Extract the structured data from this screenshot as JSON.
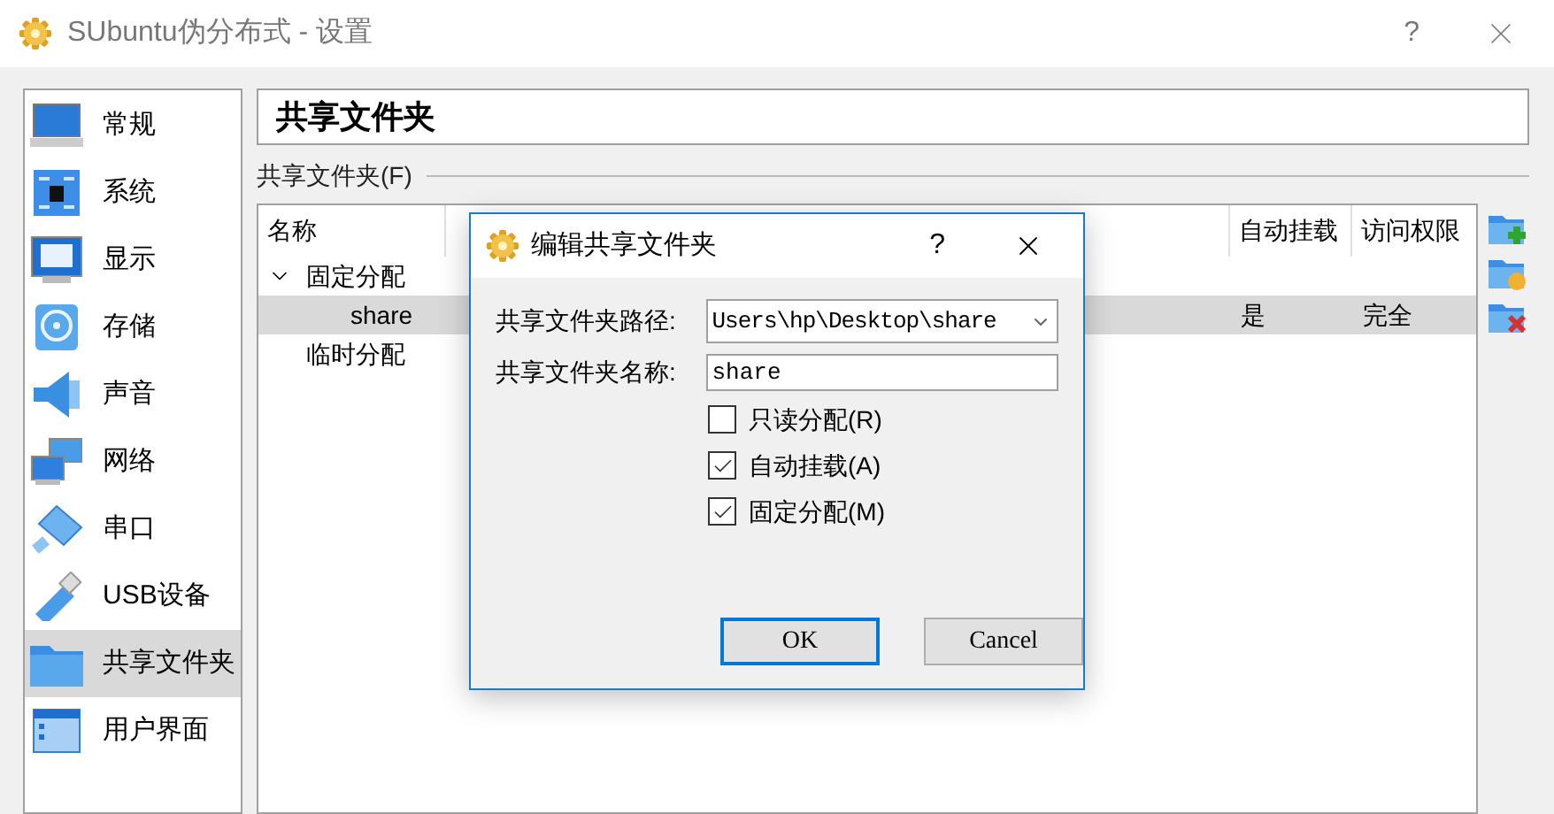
{
  "window": {
    "title": "SUbuntu伪分布式 - 设置",
    "help": "?"
  },
  "sidebar": {
    "items": [
      {
        "label": "常规",
        "kind": "monitor",
        "selected": false
      },
      {
        "label": "系统",
        "kind": "chip",
        "selected": false
      },
      {
        "label": "显示",
        "kind": "display",
        "selected": false
      },
      {
        "label": "存储",
        "kind": "disk",
        "selected": false
      },
      {
        "label": "声音",
        "kind": "speaker",
        "selected": false
      },
      {
        "label": "网络",
        "kind": "network",
        "selected": false
      },
      {
        "label": "串口",
        "kind": "serial",
        "selected": false
      },
      {
        "label": "USB设备",
        "kind": "usb",
        "selected": false
      },
      {
        "label": "共享文件夹",
        "kind": "folder",
        "selected": true
      },
      {
        "label": "用户界面",
        "kind": "window",
        "selected": false
      }
    ]
  },
  "page_title": "共享文件夹",
  "group_label": "共享文件夹(F)",
  "table": {
    "columns": [
      "名称",
      "自动挂载",
      "访问权限"
    ],
    "groups": [
      {
        "label": "固定分配",
        "expanded": true,
        "children": [
          {
            "name": "share",
            "auto_mount": "是",
            "access": "完全",
            "selected": true
          }
        ]
      },
      {
        "label": "临时分配"
      }
    ]
  },
  "side_buttons": [
    {
      "kind": "add"
    },
    {
      "kind": "edit"
    },
    {
      "kind": "remove"
    }
  ],
  "dialog": {
    "title": "编辑共享文件夹",
    "help": "?",
    "fields": [
      {
        "label": "共享文件夹路径:",
        "value": "Users\\hp\\Desktop\\share",
        "kind": "combo"
      },
      {
        "label": "共享文件夹名称:",
        "value": "share",
        "kind": "text"
      }
    ],
    "options": [
      {
        "label": "只读分配(R)",
        "checked": false
      },
      {
        "label": "自动挂载(A)",
        "checked": true
      },
      {
        "label": "固定分配(M)",
        "checked": true
      }
    ],
    "buttons": [
      {
        "label": "OK",
        "default": true
      },
      {
        "label": "Cancel",
        "default": false
      }
    ]
  }
}
